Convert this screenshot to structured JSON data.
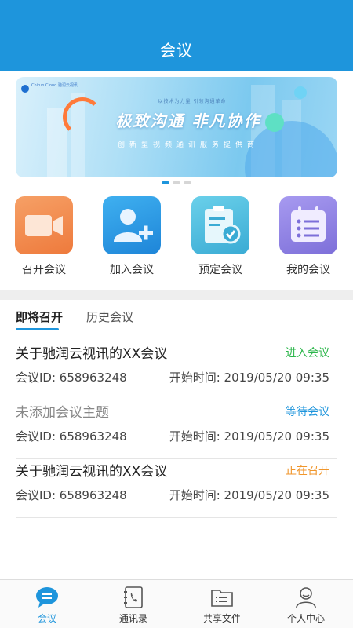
{
  "header": {
    "title": "会议"
  },
  "banner": {
    "logo_text": "Chirun Cloud 驰润云视讯",
    "small_slogan": "以技术为力量  引领沟通革命",
    "slogan": "极致沟通  非凡协作",
    "subslogan": "创新型视频通讯服务提供商",
    "page_count": 3,
    "active_page": 1
  },
  "quick_actions": [
    {
      "label": "召开会议",
      "icon": "video-camera-icon",
      "color": "#f07a3c"
    },
    {
      "label": "加入会议",
      "icon": "user-add-icon",
      "color": "#1e95dc"
    },
    {
      "label": "预定会议",
      "icon": "clipboard-check-icon",
      "color": "#3fb4d8"
    },
    {
      "label": "我的会议",
      "icon": "calendar-list-icon",
      "color": "#8a7ee0"
    }
  ],
  "tabs": {
    "upcoming": "即将召开",
    "history": "历史会议",
    "active": "upcoming"
  },
  "meetings": [
    {
      "title": "关于驰润云视讯的XX会议",
      "status": "进入会议",
      "status_color": "#2bb64a",
      "id_text": "会议ID: 658963248",
      "time_text": "开始时间: 2019/05/20 09:35"
    },
    {
      "title": "未添加会议主题",
      "status": "等待会议",
      "status_color": "#1e95dc",
      "id_text": "会议ID: 658963248",
      "time_text": "开始时间: 2019/05/20 09:35"
    },
    {
      "title": "关于驰润云视讯的XX会议",
      "status": "正在召开",
      "status_color": "#f0962c",
      "id_text": "会议ID: 658963248",
      "time_text": "开始时间: 2019/05/20 09:35"
    }
  ],
  "bottom_nav": [
    {
      "label": "会议",
      "icon": "chat-bubble-icon",
      "active": true
    },
    {
      "label": "通讯录",
      "icon": "phone-book-icon",
      "active": false
    },
    {
      "label": "共享文件",
      "icon": "folder-icon",
      "active": false
    },
    {
      "label": "个人中心",
      "icon": "person-icon",
      "active": false
    }
  ],
  "colors": {
    "primary": "#1e95dc",
    "enter": "#2bb64a",
    "waiting": "#1e95dc",
    "ongoing": "#f0962c"
  }
}
